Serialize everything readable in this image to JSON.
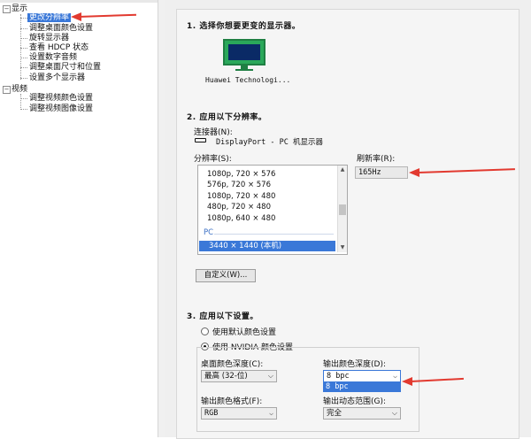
{
  "tree": {
    "display_label": "显示",
    "display_items": [
      "更改分辨率",
      "调整桌面颜色设置",
      "旋转显示器",
      "查看 HDCP 状态",
      "设置数字音频",
      "调整桌面尺寸和位置",
      "设置多个显示器"
    ],
    "video_label": "视频",
    "video_items": [
      "调整视频颜色设置",
      "调整视频图像设置"
    ],
    "selected_index": 0
  },
  "section1": {
    "title": "1. 选择你想要更变的显示器。",
    "monitor_label": "Huawei Technologi..."
  },
  "section2": {
    "title": "2. 应用以下分辨率。",
    "connector_label": "连接器(N):",
    "connector_value": "DisplayPort - PC 机显示器",
    "resolution_label": "分辨率(S):",
    "refresh_label": "刷新率(R):",
    "refresh_value": "165Hz",
    "list_items": [
      "1080p, 720 × 576",
      "576p, 720 × 576",
      "1080p, 720 × 480",
      "480p, 720 × 480",
      "1080p, 640 × 480"
    ],
    "group_pc": "PC",
    "selected_item": "3440 × 1440 (本机)",
    "customize_button": "自定义(W)..."
  },
  "section3": {
    "title": "3. 应用以下设置。",
    "radio_default": "使用默认颜色设置",
    "radio_nvidia": "使用 NVIDIA 颜色设置",
    "desktop_depth_label": "桌面颜色深度(C):",
    "desktop_depth_value": "最高 (32-位)",
    "output_depth_label": "输出颜色深度(D):",
    "output_depth_value": "8 bpc",
    "output_depth_option": "8 bpc",
    "output_format_label": "输出颜色格式(F):",
    "output_format_value": "RGB",
    "output_range_label": "输出动态范围(G):",
    "output_range_value": "完全"
  },
  "colors": {
    "accent": "#3a78d8",
    "annotation_arrow": "#e23a30",
    "monitor_green": "#2aa85a"
  }
}
